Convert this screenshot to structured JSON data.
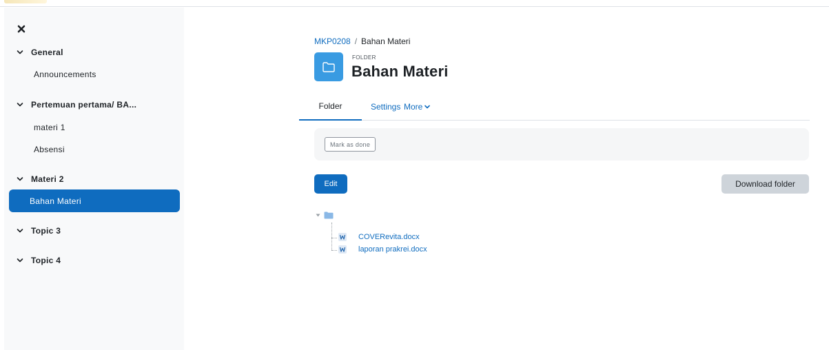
{
  "drawer": {
    "close_icon": "close-icon",
    "sections": [
      {
        "label": "General",
        "items": [
          "Announcements"
        ]
      },
      {
        "label": "Pertemuan pertama/ BA...",
        "items": [
          "materi 1",
          "Absensi"
        ]
      },
      {
        "label": "Materi 2",
        "items": [
          "Bahan Materi"
        ],
        "active_item": "Bahan Materi"
      },
      {
        "label": "Topic 3",
        "items": []
      },
      {
        "label": "Topic 4",
        "items": []
      }
    ]
  },
  "breadcrumb": {
    "course": "MKP0208",
    "separator": "/",
    "current": "Bahan Materi"
  },
  "header": {
    "type_label": "FOLDER",
    "title": "Bahan Materi",
    "icon": "folder-icon"
  },
  "tabs": [
    {
      "label": "Folder",
      "active": true
    },
    {
      "label": "Settings",
      "active": false
    },
    {
      "label": "More",
      "active": false
    }
  ],
  "completion": {
    "button_label": "Mark as done"
  },
  "actions": {
    "edit_label": "Edit",
    "download_label": "Download folder"
  },
  "files": [
    {
      "name": "COVERevita.docx",
      "icon": "word-file-icon"
    },
    {
      "name": "laporan prakrei.docx",
      "icon": "word-file-icon"
    }
  ],
  "colors": {
    "brand": "#0f6cbf",
    "folder_icon_bg": "#399be2",
    "drawer_bg": "#f8f9fa",
    "secondary_button": "#ced4da"
  }
}
